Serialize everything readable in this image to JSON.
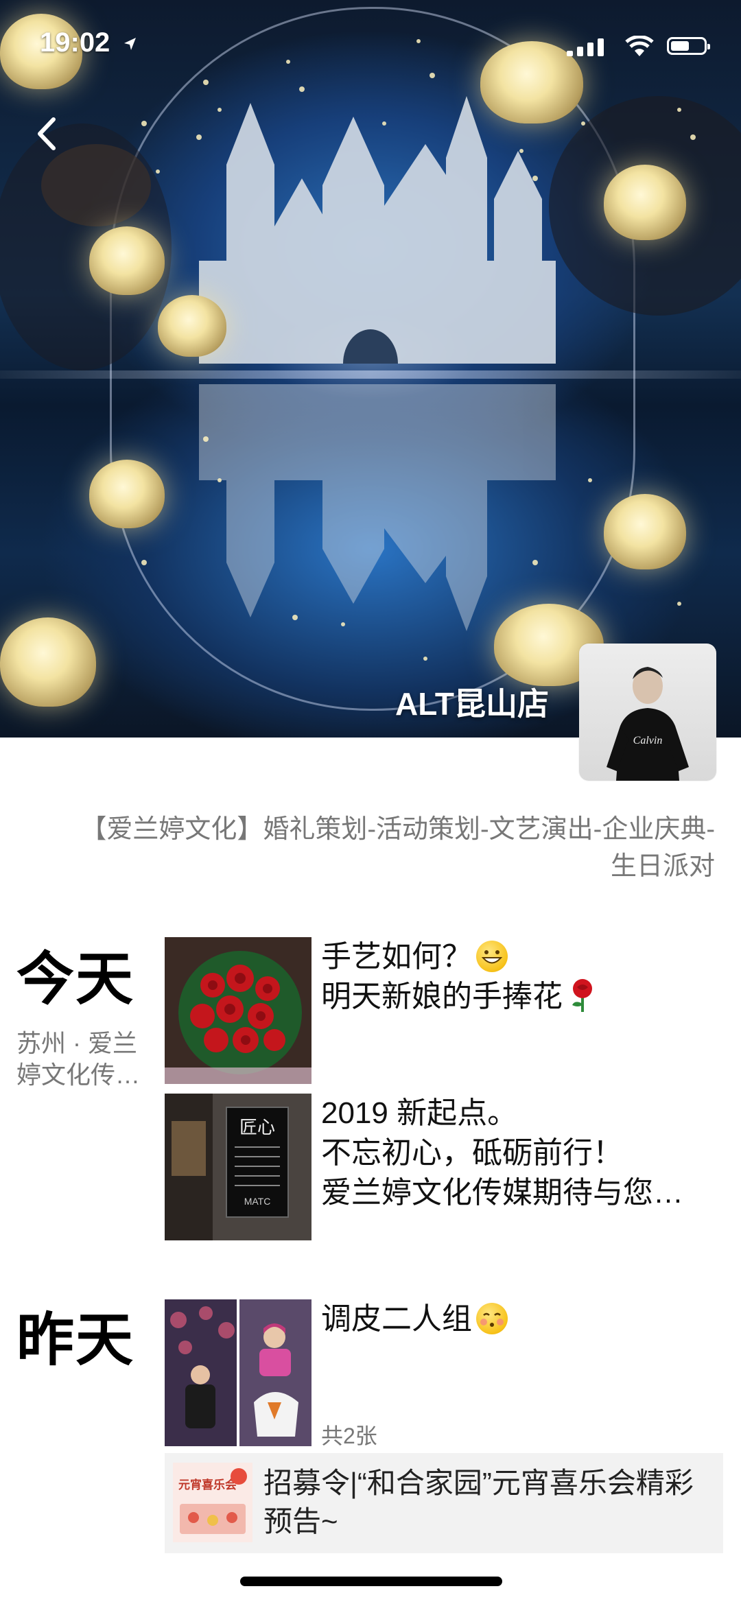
{
  "status_bar": {
    "time": "19:02"
  },
  "profile": {
    "store_name": "ALT昆山店",
    "signature": "【爱兰婷文化】婚礼策划-活动策划-文艺演出-企业庆典-生日派对"
  },
  "feed": {
    "today": {
      "label": "今天",
      "location": "苏州 · 爱兰婷文化传…",
      "posts": [
        {
          "line1": "手艺如何？",
          "line2": "明天新娘的手捧花"
        },
        {
          "line1": "2019 新起点。",
          "line2": "不忘初心，砥砺前行！",
          "line3": "爱兰婷文化传媒期待与您…",
          "thumb_sign": "匠心",
          "thumb_sign_sub": "MATC"
        }
      ]
    },
    "yesterday": {
      "label": "昨天",
      "posts": [
        {
          "text": "调皮二人组",
          "count": "共2张"
        }
      ],
      "share": {
        "title": "招募令|“和合家园”元宵喜乐会精彩预告~",
        "thumb_text": "元宵喜乐会"
      }
    }
  },
  "colors": {
    "secondary_text": "#777777",
    "card_bg": "#f2f2f2"
  },
  "icons": [
    "location-arrow-icon",
    "signal-icon",
    "wifi-icon",
    "battery-icon",
    "back-chevron-icon",
    "grin-emoji-icon",
    "rose-emoji-icon",
    "blush-emoji-icon"
  ]
}
